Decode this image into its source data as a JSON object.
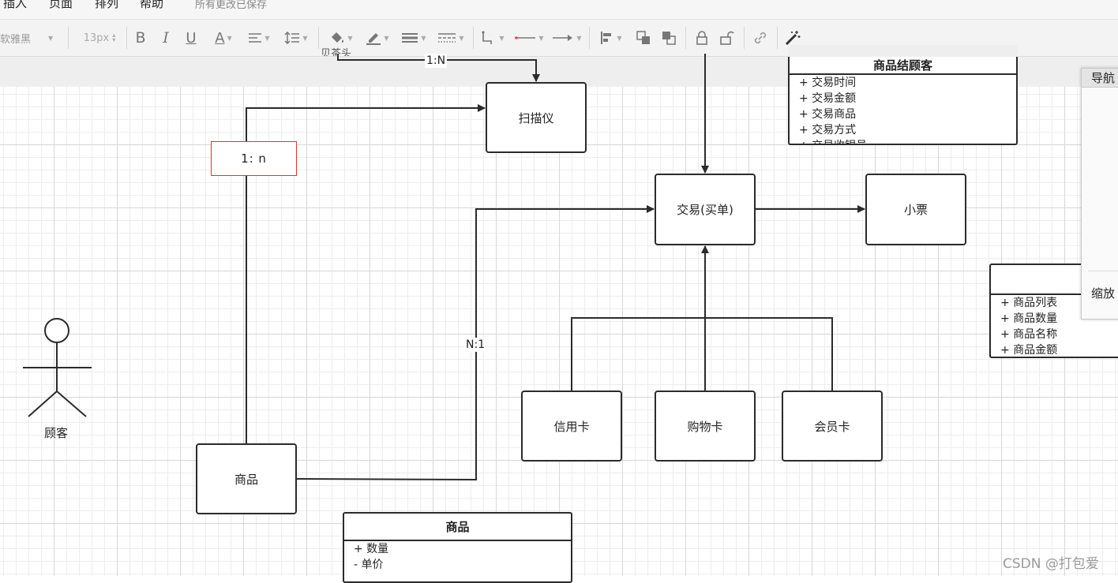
{
  "menu": {
    "items": [
      "插入",
      "页面",
      "排列",
      "帮助"
    ],
    "saved": "所有更改已保存"
  },
  "toolbar": {
    "font": "软雅黑",
    "font_size": "13px",
    "bold": "B",
    "italic": "I",
    "underline": "U",
    "font_color": "A",
    "icons": [
      "align-icon",
      "line-spacing-icon",
      "fill-color-icon",
      "line-color-icon",
      "line-width-icon",
      "line-style-icon",
      "connector-icon",
      "line-end-icon",
      "arrow-icon",
      "align-objects-icon",
      "to-front-icon",
      "to-back-icon",
      "lock-icon",
      "unlock-icon",
      "link-icon",
      "magic-icon"
    ]
  },
  "diagram": {
    "scanner": "扫描仪",
    "transaction": "交易(买单)",
    "receipt": "小票",
    "credit_card": "信用卡",
    "shopping_card": "购物卡",
    "member_card": "会员卡",
    "product": "商品",
    "actor": "顾客",
    "label_top": "1:N",
    "label_cut": "贝茶头",
    "label_n1": "N:1",
    "label_1n": "1:  n",
    "class_top": {
      "title": "商品结顾客",
      "attrs": [
        "+ 交易时间",
        "+ 交易金额",
        "+ 交易商品",
        "+ 交易方式",
        "+ 交易收银员"
      ]
    },
    "class_right": {
      "attrs": [
        "+ 商品列表",
        "+ 商品数量",
        "+ 商品名称",
        "+ 商品金额"
      ]
    },
    "class_product": {
      "title": "商品",
      "attrs": [
        "+ 数量",
        "- 单价"
      ]
    }
  },
  "nav": {
    "title": "导航",
    "zoom": "缩放"
  },
  "watermark": "CSDN @打包爱"
}
